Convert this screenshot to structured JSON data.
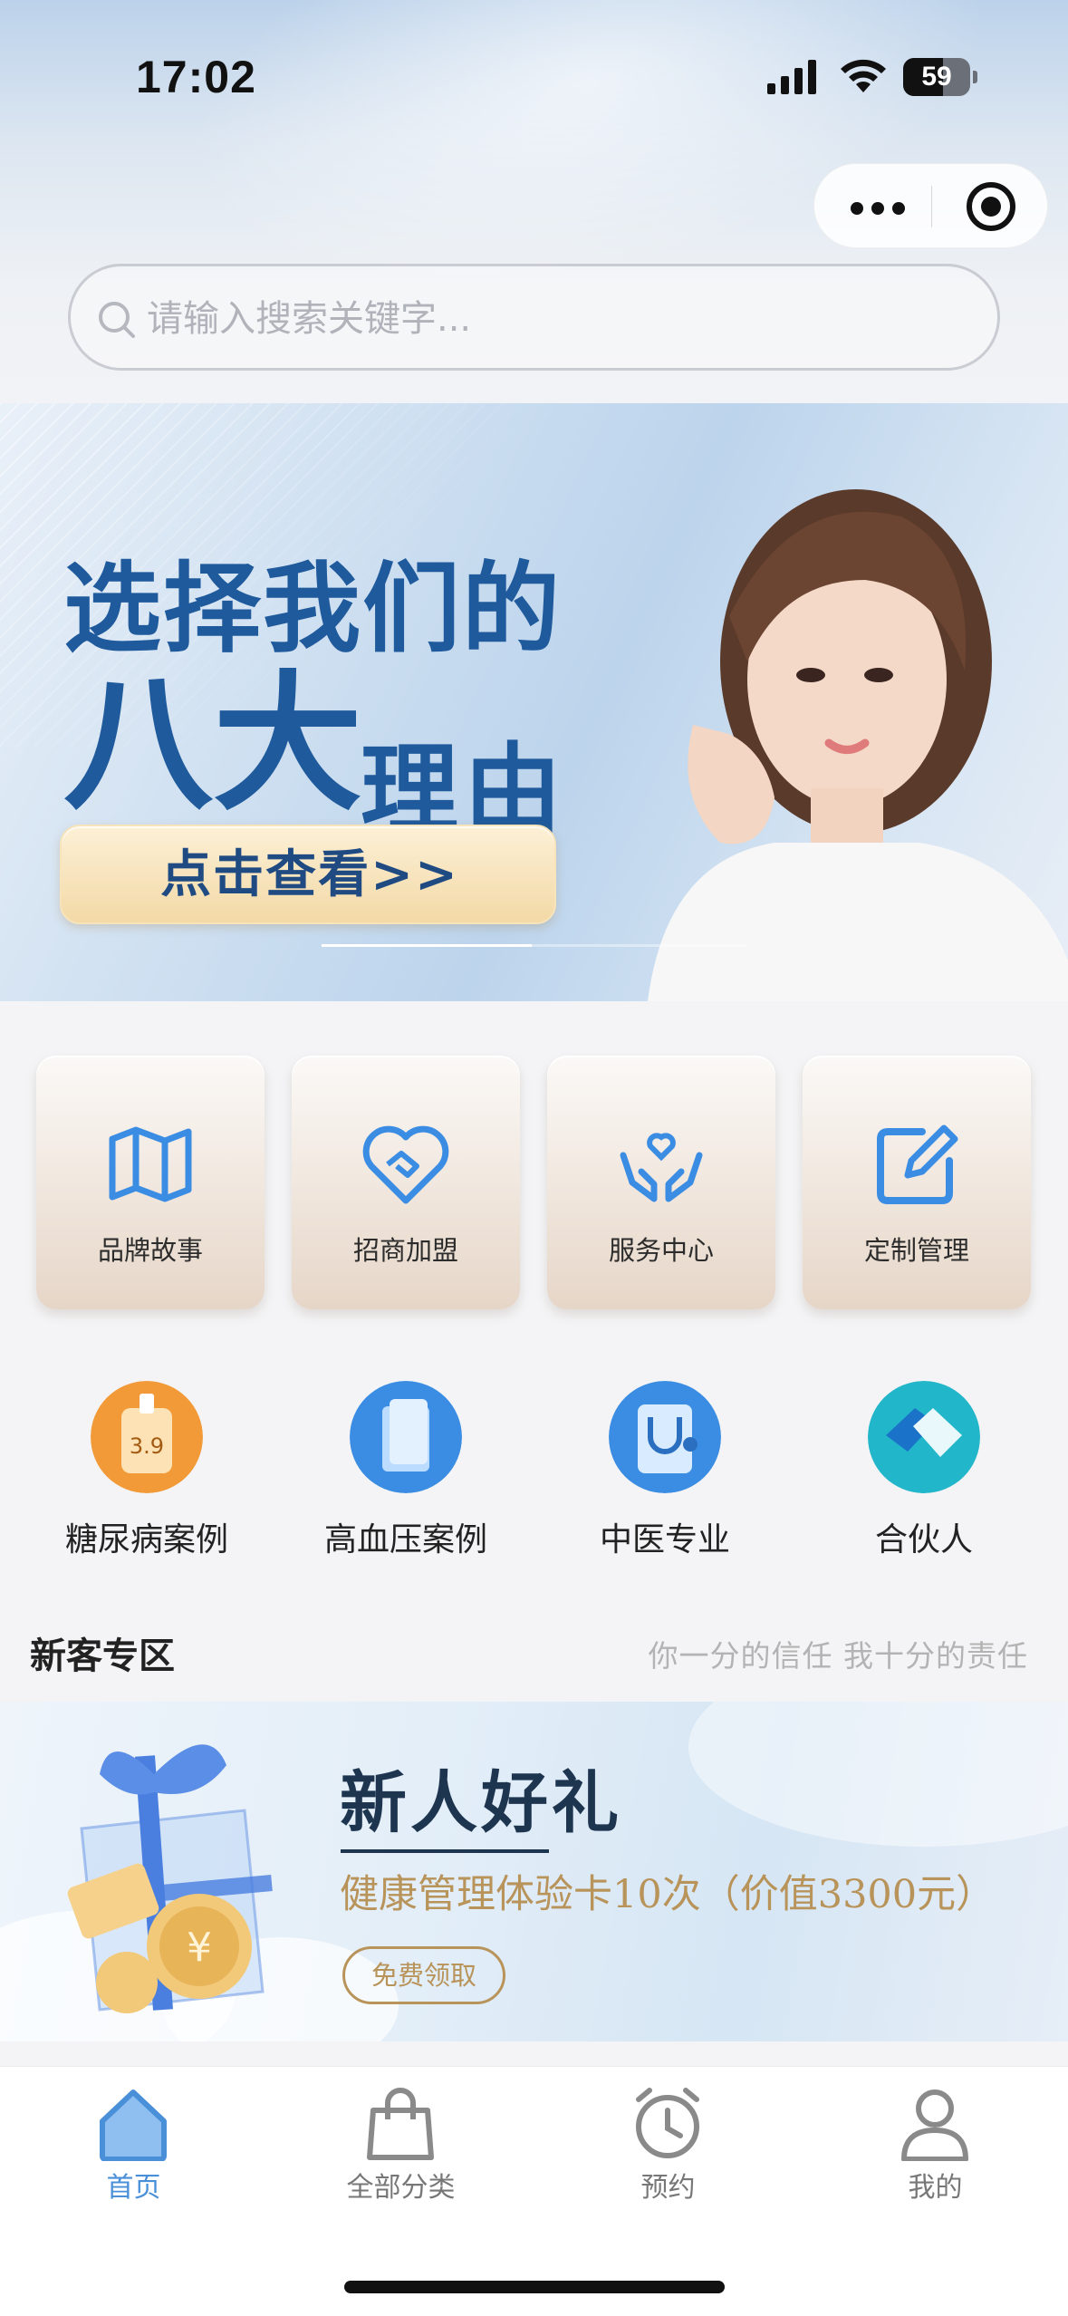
{
  "status_bar": {
    "time": "17:02",
    "battery": "59"
  },
  "search": {
    "placeholder": "请输入搜索关键字..."
  },
  "banner": {
    "title_line1": "选择我们的",
    "title_big": "八大",
    "title_small": "理由",
    "cta": "点击查看>>"
  },
  "feature_cards": [
    {
      "label": "品牌故事",
      "icon": "map-icon"
    },
    {
      "label": "招商加盟",
      "icon": "handshake-heart-icon"
    },
    {
      "label": "服务中心",
      "icon": "hands-heart-icon"
    },
    {
      "label": "定制管理",
      "icon": "edit-icon"
    }
  ],
  "round_items": [
    {
      "label": "糖尿病案例",
      "icon": "glucose-meter-icon",
      "color": "#f29a38"
    },
    {
      "label": "高血压案例",
      "icon": "folder-icon",
      "color": "#3b8de3"
    },
    {
      "label": "中医专业",
      "icon": "stethoscope-icon",
      "color": "#3b8de3"
    },
    {
      "label": "合伙人",
      "icon": "handshake-icon",
      "color": "#21b6c9"
    }
  ],
  "new_customer": {
    "title": "新客专区",
    "slogan": "你一分的信任  我十分的责任",
    "promo_title": "新人好礼",
    "promo_desc": "健康管理体验卡10次（价值3300元）",
    "promo_button": "免费领取"
  },
  "tabbar": [
    {
      "label": "首页",
      "icon": "home-icon",
      "active": true
    },
    {
      "label": "全部分类",
      "icon": "shopping-bag-icon",
      "active": false
    },
    {
      "label": "预约",
      "icon": "alarm-clock-icon",
      "active": false
    },
    {
      "label": "我的",
      "icon": "user-icon",
      "active": false
    }
  ],
  "colors": {
    "brand_blue": "#1f5a9c",
    "accent_blue": "#4a90d9",
    "gold": "#b8935a"
  }
}
